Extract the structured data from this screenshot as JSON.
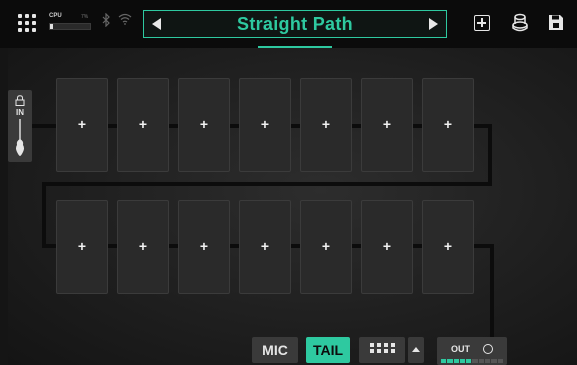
{
  "topbar": {
    "cpu_label": "CPU",
    "cpu_percent": "7%",
    "cpu_fill_percent": 7,
    "preset_name": "Straight Path"
  },
  "input": {
    "label": "IN"
  },
  "grid": {
    "row1_slots": [
      "+",
      "+",
      "+",
      "+",
      "+",
      "+",
      "+"
    ],
    "row2_slots": [
      "+",
      "+",
      "+",
      "+",
      "+",
      "+",
      "+"
    ]
  },
  "bottom": {
    "mic_label": "MIC",
    "tail_label": "TAIL",
    "out_label": "OUT",
    "out_meter_level": 0.5
  },
  "colors": {
    "accent": "#2ec9a0",
    "background": "#151515",
    "slot": "#2a2a2a"
  }
}
